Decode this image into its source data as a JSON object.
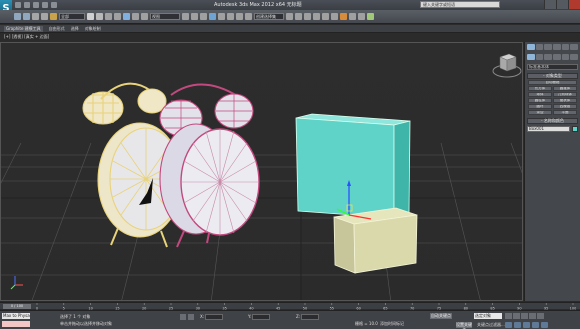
{
  "app": {
    "logo": "S",
    "title": "Autodesk 3ds Max 2012 x64    无标题",
    "search_placeholder": "键入关键字或短语"
  },
  "toolbar": {
    "selection_filter": "全部",
    "ref_coord": "视图",
    "named_selection": "创建选择集"
  },
  "ribbon": {
    "items": [
      "Graphite 建模工具",
      "自由形式",
      "选择",
      "对象绘制"
    ]
  },
  "viewport": {
    "breadcrumb": "[+] [透视] [真实 + 边面]"
  },
  "command_panel": {
    "category": "标准基本体",
    "object_type_header": "- 对象类型",
    "autogrid_label": "自动栅格",
    "primitives": [
      "长方体",
      "圆锥体",
      "球体",
      "几何球体",
      "圆柱体",
      "管状体",
      "圆环",
      "四棱锥",
      "茶壶",
      "平面"
    ],
    "name_color_header": "- 名称和颜色",
    "object_name": "Box001",
    "object_color": "#5fd3c8"
  },
  "timeline": {
    "frame": "0 / 100",
    "ticks": [
      "0",
      "5",
      "10",
      "15",
      "20",
      "25",
      "30",
      "35",
      "40",
      "45",
      "50",
      "55",
      "60",
      "65",
      "70",
      "75",
      "80",
      "85",
      "90",
      "95",
      "100"
    ]
  },
  "status": {
    "maxscript": "Max to Physac",
    "line1": "选择了 1 个 对象",
    "line2": "单击并拖动以选择并移动对象",
    "x_label": "X:",
    "y_label": "Y:",
    "z_label": "Z:",
    "grid": "栅格 = 10.0",
    "autokey": "自动关键点",
    "selection_mode": "选定对象",
    "setkey": "设置关键点",
    "key_filters": "关键点过滤器...",
    "add_time_tag": "添加时间标记"
  },
  "colors": {
    "clock_yellow": "#e8d27a",
    "clock_pink": "#c2497e",
    "box_teal": "#5fd3c8",
    "box_cream": "#d9d9ac",
    "grid": "#5a5a5a"
  }
}
